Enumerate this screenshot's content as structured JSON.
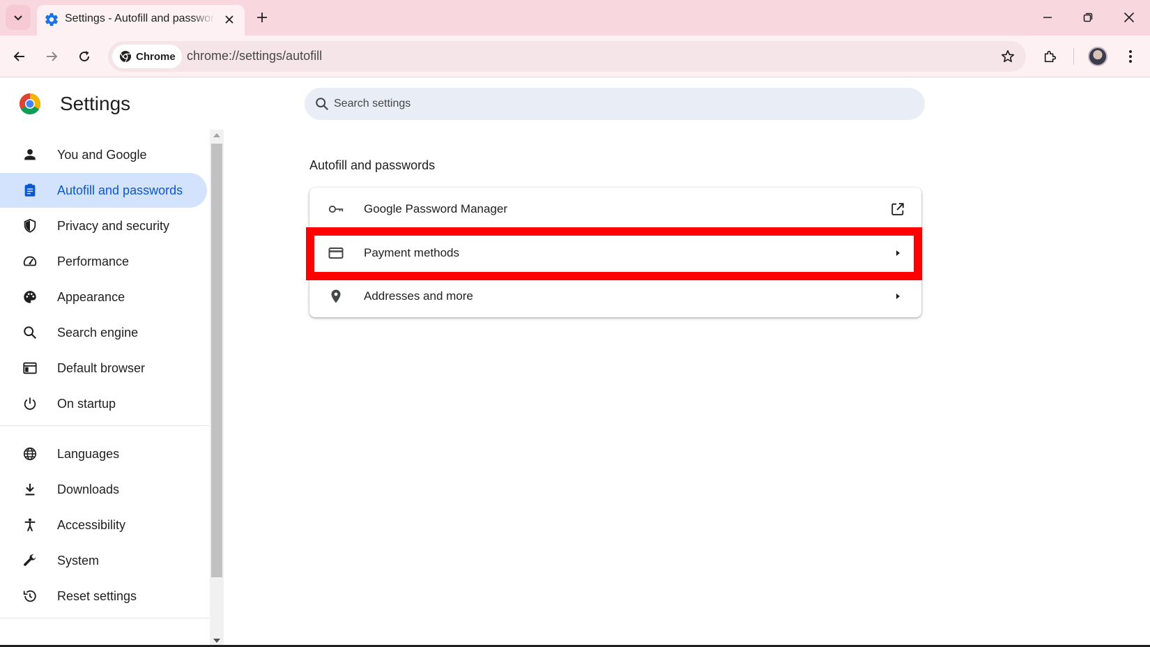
{
  "browser": {
    "tab": {
      "title": "Settings - Autofill and passwords"
    },
    "omnibox": {
      "chip_label": "Chrome",
      "url": "chrome://settings/autofill"
    }
  },
  "settings": {
    "title": "Settings",
    "search": {
      "placeholder": "Search settings"
    },
    "sidebar": {
      "items": [
        {
          "label": "You and Google",
          "icon": "person-icon"
        },
        {
          "label": "Autofill and passwords",
          "icon": "clipboard-icon",
          "active": true
        },
        {
          "label": "Privacy and security",
          "icon": "shield-icon"
        },
        {
          "label": "Performance",
          "icon": "speedometer-icon"
        },
        {
          "label": "Appearance",
          "icon": "palette-icon"
        },
        {
          "label": "Search engine",
          "icon": "search-icon"
        },
        {
          "label": "Default browser",
          "icon": "browser-window-icon"
        },
        {
          "label": "On startup",
          "icon": "power-icon"
        },
        {
          "label": "Languages",
          "icon": "globe-icon"
        },
        {
          "label": "Downloads",
          "icon": "download-icon"
        },
        {
          "label": "Accessibility",
          "icon": "accessibility-icon"
        },
        {
          "label": "System",
          "icon": "wrench-icon"
        },
        {
          "label": "Reset settings",
          "icon": "history-icon"
        }
      ]
    },
    "main": {
      "section_title": "Autofill and passwords",
      "rows": [
        {
          "label": "Google Password Manager",
          "icon": "key-icon",
          "end_icon": "open-external-icon"
        },
        {
          "label": "Payment methods",
          "icon": "credit-card-icon",
          "end_icon": "arrow-right-icon",
          "highlighted": true
        },
        {
          "label": "Addresses and more",
          "icon": "location-pin-icon",
          "end_icon": "arrow-right-icon"
        }
      ]
    }
  },
  "colors": {
    "tabstrip_bg": "#f9d7de",
    "toolbar_bg": "#fdf1f3",
    "active_nav_bg": "#d3e3fd",
    "active_nav_text": "#0b57d0",
    "highlight": "#ff0000"
  }
}
